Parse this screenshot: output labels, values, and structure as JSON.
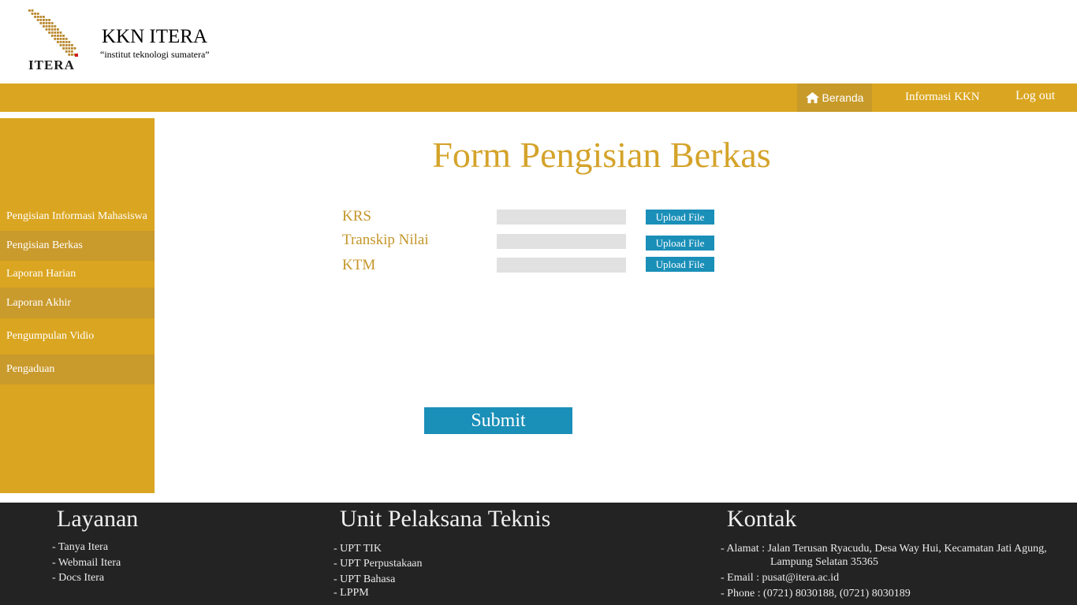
{
  "header": {
    "logo_text": "ITERA",
    "title": "KKN ITERA",
    "tagline": "“institut teknologi sumatera”"
  },
  "nav": {
    "home": "Beranda",
    "info": "Informasi KKN",
    "logout": "Log out"
  },
  "sidebar": {
    "items": [
      {
        "label": "Pengisian Informasi Mahasiswa"
      },
      {
        "label": "Pengisian Berkas"
      },
      {
        "label": "Laporan Harian"
      },
      {
        "label": "Laporan Akhir"
      },
      {
        "label": "Pengumpulan Vidio"
      },
      {
        "label": "Pengaduan"
      }
    ]
  },
  "form": {
    "title": "Form Pengisian Berkas",
    "fields": [
      {
        "label": "KRS",
        "value": "",
        "button": "Upload File"
      },
      {
        "label": "Transkip Nilai",
        "value": "",
        "button": "Upload File"
      },
      {
        "label": "KTM",
        "value": "",
        "button": "Upload File"
      }
    ],
    "submit": "Submit"
  },
  "footer": {
    "layanan": {
      "title": "Layanan",
      "items": [
        "- Tanya Itera",
        "- Webmail Itera",
        "- Docs Itera"
      ]
    },
    "upt": {
      "title": "Unit Pelaksana Teknis",
      "items": [
        "- UPT TIK",
        "- UPT Perpustakaan",
        "- UPT Bahasa",
        "- LPPM"
      ]
    },
    "kontak": {
      "title": "Kontak",
      "alamat": "- Alamat : Jalan Terusan Ryacudu, Desa Way Hui, Kecamatan Jati Agung,",
      "alamat2": "Lampung Selatan 35365",
      "email": "- Email : pusat@itera.ac.id",
      "phone": "- Phone : (0721) 8030188, (0721) 8030189"
    }
  },
  "colors": {
    "accent_gold": "#daa520",
    "button_blue": "#1a8fb8",
    "footer_bg": "#232323"
  }
}
